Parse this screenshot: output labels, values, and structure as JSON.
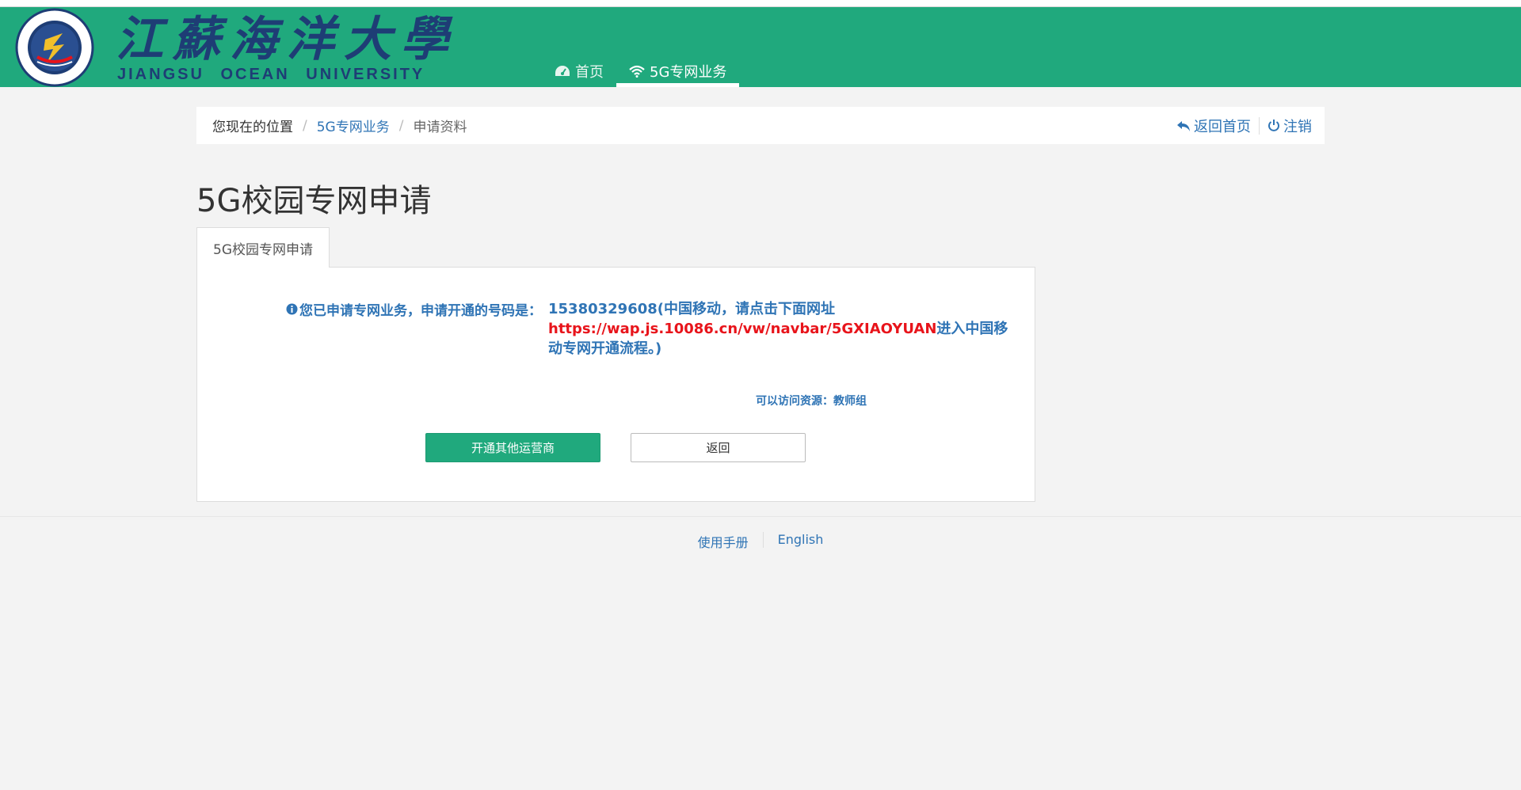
{
  "header": {
    "brand_cn": "江蘇海洋大學",
    "brand_en": "JIANGSU OCEAN UNIVERSITY",
    "logo_ring_text": "JIANGSU OCEAN UNIVERSITY",
    "nav": [
      {
        "label": "首页",
        "icon": "dashboard-icon"
      },
      {
        "label": "5G专网业务",
        "icon": "wifi-icon",
        "active": true
      }
    ],
    "accent_color": "#20a97d"
  },
  "breadcrumb": {
    "here": "您现在的位置",
    "items": [
      "5G专网业务",
      "申请资料"
    ]
  },
  "actions": {
    "home_label": "返回首页",
    "logout_label": "注销"
  },
  "page": {
    "title": "5G校园专网申请",
    "tab_label": "5G校园专网申请"
  },
  "message": {
    "label": "您已申请专网业务，申请开通的号码是：",
    "line1": "15380329608(中国移动，请点击下面网址",
    "url": "https://wap.js.10086.cn/vw/navbar/5GXIAOYUAN",
    "line2": "进入中国移动专网开通流程。)",
    "resources": "可以访问资源：教师组"
  },
  "buttons": {
    "primary": "开通其他运营商",
    "back": "返回"
  },
  "footer": {
    "manual": "使用手册",
    "english": "English"
  }
}
